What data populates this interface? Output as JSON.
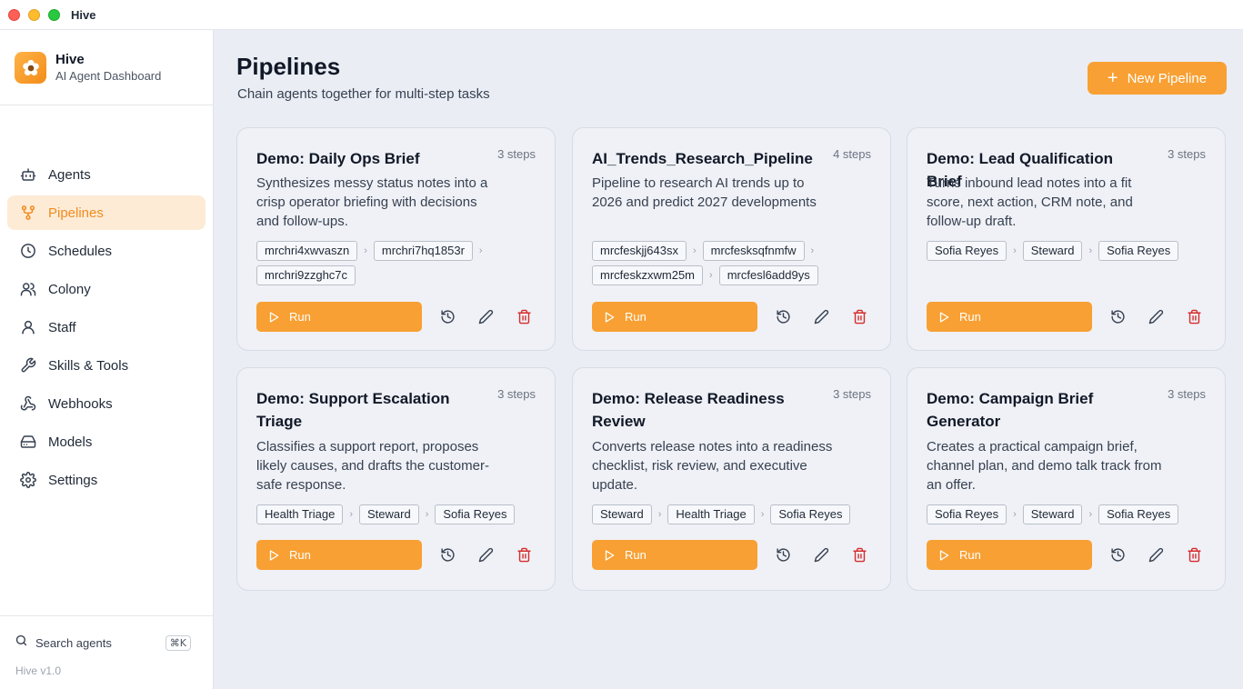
{
  "window": {
    "title": "Hive"
  },
  "brand": {
    "name": "Hive",
    "subtitle": "AI Agent Dashboard"
  },
  "nav": [
    {
      "label": "Agents",
      "icon": "bot-icon",
      "active": false
    },
    {
      "label": "Pipelines",
      "icon": "pipeline-icon",
      "active": true
    },
    {
      "label": "Schedules",
      "icon": "clock-icon",
      "active": false
    },
    {
      "label": "Colony",
      "icon": "users-icon",
      "active": false
    },
    {
      "label": "Staff",
      "icon": "user-icon",
      "active": false
    },
    {
      "label": "Skills & Tools",
      "icon": "wrench-icon",
      "active": false
    },
    {
      "label": "Webhooks",
      "icon": "webhook-icon",
      "active": false
    },
    {
      "label": "Models",
      "icon": "drive-icon",
      "active": false
    },
    {
      "label": "Settings",
      "icon": "gear-icon",
      "active": false
    }
  ],
  "search": {
    "label": "Search agents",
    "shortcut": "⌘K"
  },
  "version": "Hive v1.0",
  "header": {
    "title": "Pipelines",
    "subtitle": "Chain agents together for multi-step tasks",
    "new_button": "New Pipeline"
  },
  "colors": {
    "accent": "#f8a033",
    "active_bg": "#fdebd6",
    "delete": "#d62c2c"
  },
  "run_label": "Run",
  "pipelines": [
    {
      "title": "Demo: Daily Ops Brief",
      "steps": "3 steps",
      "description": "Synthesizes messy status notes into a crisp operator briefing with decisions and follow-ups.",
      "agents": [
        "mrchri4xwvaszn",
        "mrchri7hq1853r",
        "mrchri9zzghc7c"
      ]
    },
    {
      "title": "AI_Trends_Research_Pipeline",
      "steps": "4 steps",
      "description": "Pipeline to research AI trends up to 2026 and predict 2027 developments",
      "agents": [
        "mrcfeskjj643sx",
        "mrcfesksqfnmfw",
        "mrcfeskzxwm25m",
        "mrcfesl6add9ys"
      ]
    },
    {
      "title": "Demo: Lead Qualification Brief",
      "steps": "3 steps",
      "description": "Turns inbound lead notes into a fit score, next action, CRM note, and follow-up draft.",
      "agents": [
        "Sofia Reyes",
        "Steward",
        "Sofia Reyes"
      ]
    },
    {
      "title": "Demo: Support Escalation Triage",
      "steps": "3 steps",
      "description": "Classifies a support report, proposes likely causes, and drafts the customer-safe response.",
      "agents": [
        "Health Triage",
        "Steward",
        "Sofia Reyes"
      ]
    },
    {
      "title": "Demo: Release Readiness Review",
      "steps": "3 steps",
      "description": "Converts release notes into a readiness checklist, risk review, and executive update.",
      "agents": [
        "Steward",
        "Health Triage",
        "Sofia Reyes"
      ]
    },
    {
      "title": "Demo: Campaign Brief Generator",
      "steps": "3 steps",
      "description": "Creates a practical campaign brief, channel plan, and demo talk track from an offer.",
      "agents": [
        "Sofia Reyes",
        "Steward",
        "Sofia Reyes"
      ]
    }
  ]
}
